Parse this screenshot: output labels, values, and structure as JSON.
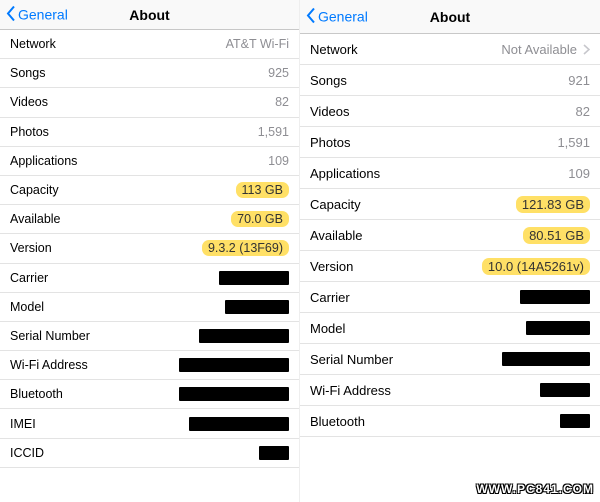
{
  "watermark": "WWW.PC841.COM",
  "left": {
    "nav": {
      "back": "General",
      "title": "About"
    },
    "rows": [
      {
        "label": "Network",
        "value": "AT&T Wi-Fi",
        "style": "plain"
      },
      {
        "label": "Songs",
        "value": "925",
        "style": "plain"
      },
      {
        "label": "Videos",
        "value": "82",
        "style": "plain"
      },
      {
        "label": "Photos",
        "value": "1,591",
        "style": "plain"
      },
      {
        "label": "Applications",
        "value": "109",
        "style": "plain"
      },
      {
        "label": "Capacity",
        "value": "113 GB",
        "style": "highlight"
      },
      {
        "label": "Available",
        "value": "70.0 GB",
        "style": "highlight"
      },
      {
        "label": "Version",
        "value": "9.3.2 (13F69)",
        "style": "highlight"
      },
      {
        "label": "Carrier",
        "value": "",
        "style": "redact",
        "redact_w": 70
      },
      {
        "label": "Model",
        "value": "",
        "style": "redact",
        "redact_w": 64
      },
      {
        "label": "Serial Number",
        "value": "",
        "style": "redact",
        "redact_w": 90
      },
      {
        "label": "Wi-Fi Address",
        "value": "",
        "style": "redact",
        "redact_w": 110
      },
      {
        "label": "Bluetooth",
        "value": "",
        "style": "redact",
        "redact_w": 110
      },
      {
        "label": "IMEI",
        "value": "",
        "style": "redact",
        "redact_w": 100
      },
      {
        "label": "ICCID",
        "value": "",
        "style": "redact",
        "redact_w": 30
      }
    ]
  },
  "right": {
    "nav": {
      "back": "General",
      "title": "About"
    },
    "rows": [
      {
        "label": "Network",
        "value": "Not Available",
        "style": "plain",
        "chevron": true
      },
      {
        "label": "Songs",
        "value": "921",
        "style": "plain"
      },
      {
        "label": "Videos",
        "value": "82",
        "style": "plain"
      },
      {
        "label": "Photos",
        "value": "1,591",
        "style": "plain"
      },
      {
        "label": "Applications",
        "value": "109",
        "style": "plain"
      },
      {
        "label": "Capacity",
        "value": "121.83 GB",
        "style": "highlight"
      },
      {
        "label": "Available",
        "value": "80.51 GB",
        "style": "highlight"
      },
      {
        "label": "Version",
        "value": "10.0 (14A5261v)",
        "style": "highlight"
      },
      {
        "label": "Carrier",
        "value": "",
        "style": "redact",
        "redact_w": 70
      },
      {
        "label": "Model",
        "value": "",
        "style": "redact",
        "redact_w": 64
      },
      {
        "label": "Serial Number",
        "value": "",
        "style": "redact",
        "redact_w": 88
      },
      {
        "label": "Wi-Fi Address",
        "value": "",
        "style": "redact",
        "redact_w": 50
      },
      {
        "label": "Bluetooth",
        "value": "",
        "style": "redact",
        "redact_w": 30
      }
    ]
  }
}
